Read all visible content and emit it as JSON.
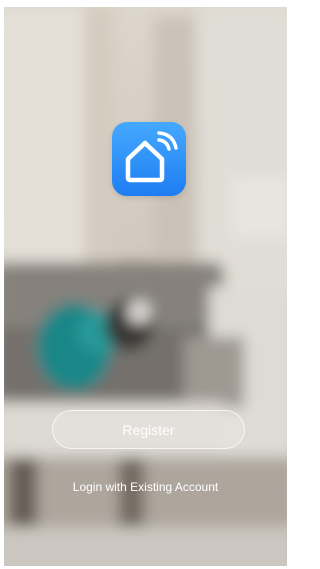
{
  "app": {
    "logo_icon": "smart-home-wifi-icon",
    "logo_color_top": "#45a9ff",
    "logo_color_bottom": "#1f7df2"
  },
  "actions": {
    "register_label": "Register",
    "login_label": "Login with Existing Account"
  },
  "background": {
    "description_icon": "blurred-living-room-photo"
  }
}
